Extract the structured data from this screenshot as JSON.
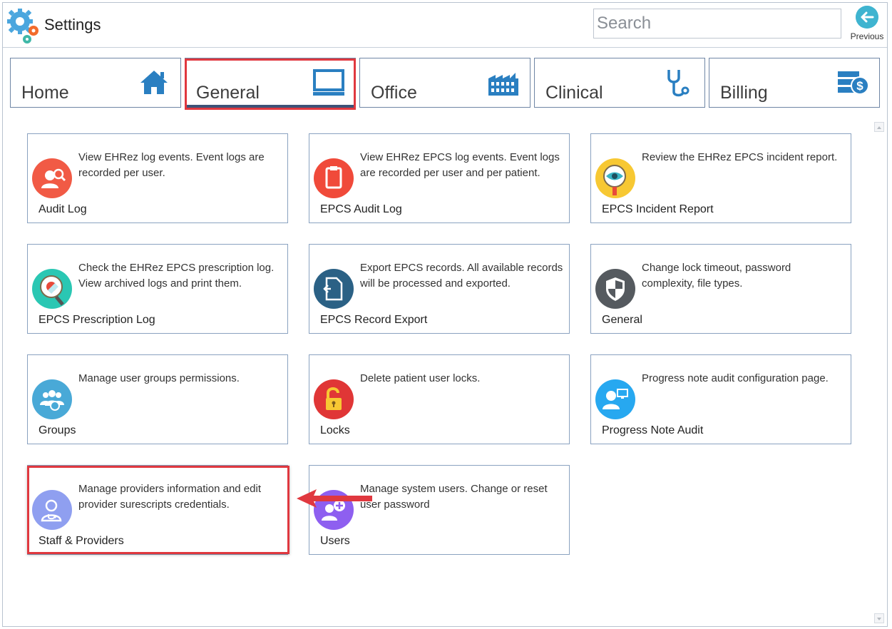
{
  "header": {
    "title": "Settings",
    "search_placeholder": "Search",
    "previous_label": "Previous"
  },
  "tabs": [
    {
      "label": "Home",
      "icon": "home-icon"
    },
    {
      "label": "General",
      "icon": "monitor-icon",
      "active": true
    },
    {
      "label": "Office",
      "icon": "factory-icon"
    },
    {
      "label": "Clinical",
      "icon": "stethoscope-icon"
    },
    {
      "label": "Billing",
      "icon": "billing-icon"
    }
  ],
  "cards": [
    {
      "title": "Audit Log",
      "desc": "View EHRez log events. Event logs are recorded per user.",
      "icon": "audit-user-search-icon",
      "color": "#f15a45"
    },
    {
      "title": "EPCS Audit Log",
      "desc": "View EHRez EPCS log events. Event logs are recorded per user and per patient.",
      "icon": "clipboard-icon",
      "color": "#f04a3a"
    },
    {
      "title": "EPCS Incident Report",
      "desc": "Review the EHRez EPCS incident report.",
      "icon": "eye-magnifier-icon",
      "color": "#f7c833"
    },
    {
      "title": "EPCS Prescription Log",
      "desc": "Check the EHRez EPCS prescription log. View archived logs and print them.",
      "icon": "pill-magnifier-icon",
      "color": "#2ac7b3"
    },
    {
      "title": "EPCS Record Export",
      "desc": "Export EPCS records. All available records will be processed and exported.",
      "icon": "export-document-icon",
      "color": "#2b6185"
    },
    {
      "title": "General",
      "desc": "Change lock timeout, password complexity, file types.",
      "icon": "shield-icon",
      "color": "#555a5f"
    },
    {
      "title": "Groups",
      "desc": "Manage user groups permissions.",
      "icon": "user-groups-icon",
      "color": "#49a9d7"
    },
    {
      "title": "Locks",
      "desc": "Delete patient user locks.",
      "icon": "padlock-icon",
      "color": "#e03636"
    },
    {
      "title": "Progress Note Audit",
      "desc": "Progress note audit configuration page.",
      "icon": "user-monitor-icon",
      "color": "#27a8f0"
    },
    {
      "title": "Staff & Providers",
      "desc": "Manage providers information and edit provider surescripts credentials.",
      "icon": "doctor-icon",
      "color": "#8f9ff0"
    },
    {
      "title": "Users",
      "desc": "Manage system users. Change or reset user password",
      "icon": "add-user-icon",
      "color": "#8e5ff0"
    }
  ]
}
